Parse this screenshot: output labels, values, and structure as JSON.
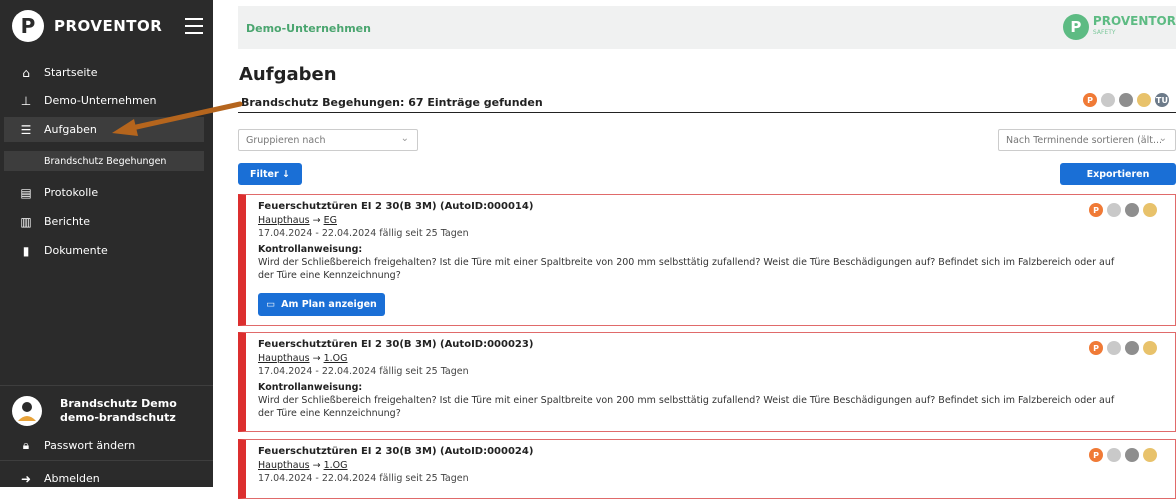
{
  "sidebar": {
    "logo_letter": "P",
    "brand": "PROVENTOR",
    "items": [
      {
        "label": "Startseite",
        "icon": "home-icon"
      },
      {
        "label": "Demo-Unternehmen",
        "icon": "org-chart-icon"
      },
      {
        "label": "Aufgaben",
        "icon": "task-list-icon"
      },
      {
        "label": "Protokolle",
        "icon": "protocol-icon"
      },
      {
        "label": "Berichte",
        "icon": "bar-chart-icon"
      },
      {
        "label": "Dokumente",
        "icon": "document-icon"
      }
    ],
    "sub_item": "Brandschutz Begehungen",
    "user": {
      "name": "Brandschutz Demo",
      "username": "demo-brandschutz"
    },
    "change_password": "Passwort ändern",
    "logout": "Abmelden"
  },
  "header": {
    "company": "Demo-Unternehmen",
    "logo_letter": "P",
    "brand": "PROVENTOR",
    "brand_sub": "SAFETY"
  },
  "main": {
    "title": "Aufgaben",
    "count_line": "Brandschutz Begehungen: 67 Einträge gefunden",
    "avatar_initials": "TU",
    "avatar_letter": "P",
    "group_by_placeholder": "Gruppieren nach",
    "sort_value": "Nach Terminende sortieren (ält...",
    "filter_label": "Filter ↓",
    "export_label": "Exportieren",
    "plan_button": "Am Plan anzeigen",
    "tasks": [
      {
        "title": "Feuerschutztüren EI 2 30(B 3M) (AutoID:000014)",
        "building": "Haupthaus",
        "arrow": "→",
        "floor": "EG",
        "date": "17.04.2024 - 22.04.2024 fällig seit 25 Tagen",
        "label": "Kontrollanweisung:",
        "text": "Wird der Schließbereich freigehalten? Ist die Türe mit einer Spaltbreite von 200 mm selbsttätig zufallend? Weist die Türe Beschädigungen auf? Befindet sich im Falzbereich oder auf der Türe eine Kennzeichnung?"
      },
      {
        "title": "Feuerschutztüren EI 2 30(B 3M) (AutoID:000023)",
        "building": "Haupthaus",
        "arrow": "→",
        "floor": "1.OG",
        "date": "17.04.2024 - 22.04.2024 fällig seit 25 Tagen",
        "label": "Kontrollanweisung:",
        "text": "Wird der Schließbereich freigehalten? Ist die Türe mit einer Spaltbreite von 200 mm selbsttätig zufallend? Weist die Türe Beschädigungen auf? Befindet sich im Falzbereich oder auf der Türe eine Kennzeichnung?"
      },
      {
        "title": "Feuerschutztüren EI 2 30(B 3M) (AutoID:000024)",
        "building": "Haupthaus",
        "arrow": "→",
        "floor": "1.OG",
        "date": "17.04.2024 - 22.04.2024 fällig seit 25 Tagen"
      }
    ]
  },
  "colors": {
    "sidebar": "#2b2b2b",
    "accent_blue": "#1a6fd6",
    "task_red": "#dc2f2f",
    "brand_green": "#5dbb83",
    "annotation_arrow": "#b5651d"
  }
}
